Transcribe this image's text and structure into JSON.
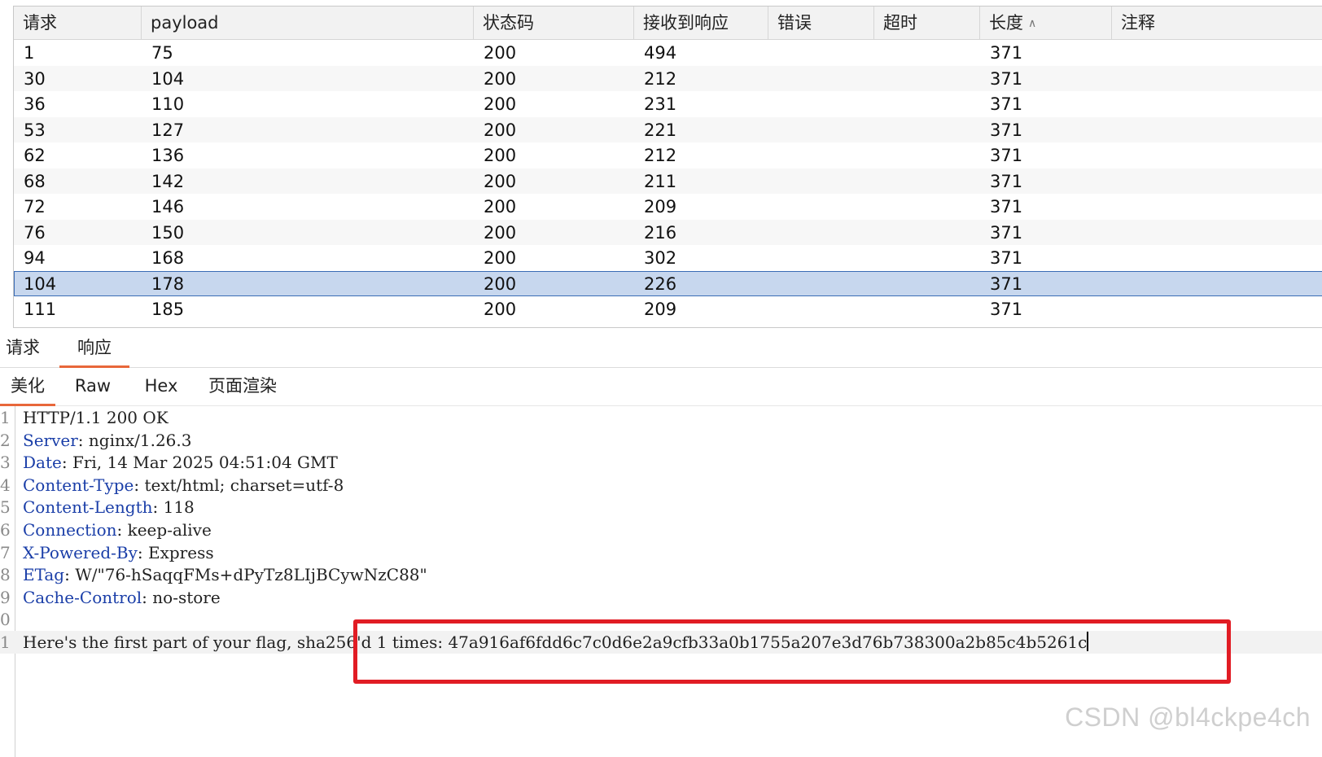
{
  "table": {
    "columns": [
      "请求",
      "payload",
      "状态码",
      "接收到响应",
      "错误",
      "超时",
      "长度",
      "注释"
    ],
    "rows": [
      [
        "1",
        "75",
        "200",
        "494",
        "",
        "",
        "371",
        ""
      ],
      [
        "30",
        "104",
        "200",
        "212",
        "",
        "",
        "371",
        ""
      ],
      [
        "36",
        "110",
        "200",
        "231",
        "",
        "",
        "371",
        ""
      ],
      [
        "53",
        "127",
        "200",
        "221",
        "",
        "",
        "371",
        ""
      ],
      [
        "62",
        "136",
        "200",
        "212",
        "",
        "",
        "371",
        ""
      ],
      [
        "68",
        "142",
        "200",
        "211",
        "",
        "",
        "371",
        ""
      ],
      [
        "72",
        "146",
        "200",
        "209",
        "",
        "",
        "371",
        ""
      ],
      [
        "76",
        "150",
        "200",
        "216",
        "",
        "",
        "371",
        ""
      ],
      [
        "94",
        "168",
        "200",
        "302",
        "",
        "",
        "371",
        ""
      ],
      [
        "104",
        "178",
        "200",
        "226",
        "",
        "",
        "371",
        ""
      ],
      [
        "111",
        "185",
        "200",
        "209",
        "",
        "",
        "371",
        ""
      ]
    ],
    "selected_row": 9,
    "sort_column": "长度",
    "sort_icon": "chevron-up-icon"
  },
  "main_tabs": [
    {
      "label": "请求",
      "active": false
    },
    {
      "label": "响应",
      "active": true
    }
  ],
  "view_tabs": [
    {
      "label": "美化",
      "active": true
    },
    {
      "label": "Raw",
      "active": false
    },
    {
      "label": "Hex",
      "active": false
    },
    {
      "label": "页面渲染",
      "active": false
    }
  ],
  "response": {
    "lines": [
      {
        "num": "1",
        "key": "",
        "value": "HTTP/1.1 200 OK"
      },
      {
        "num": "2",
        "key": "Server",
        "value": ": nginx/1.26.3"
      },
      {
        "num": "3",
        "key": "Date",
        "value": ": Fri, 14 Mar 2025 04:51:04 GMT"
      },
      {
        "num": "4",
        "key": "Content-Type",
        "value": ": text/html; charset=utf-8"
      },
      {
        "num": "5",
        "key": "Content-Length",
        "value": ": 118"
      },
      {
        "num": "6",
        "key": "Connection",
        "value": ": keep-alive"
      },
      {
        "num": "7",
        "key": "X-Powered-By",
        "value": ": Express"
      },
      {
        "num": "8",
        "key": "ETag",
        "value": ": W/\"76-hSaqqFMs+dPyTz8LIjBCywNzC88\""
      },
      {
        "num": "9",
        "key": "Cache-Control",
        "value": ": no-store"
      },
      {
        "num": "0",
        "key": "",
        "value": ""
      },
      {
        "num": "1",
        "key": "",
        "value": "Here's the first part of your flag, sha256'd 1 times: 47a916af6fdd6c7c0d6e2a9cfb33a0b1755a207e3d76b738300a2b85c4b5261c"
      }
    ],
    "current_line": 10
  },
  "colors": {
    "accent_tab": "#e8673a",
    "selected_row": "#c7d7ee",
    "header_key": "#1a3ea8",
    "highlight_box": "#e11c24"
  },
  "watermark": "CSDN @bl4ckpe4ch"
}
